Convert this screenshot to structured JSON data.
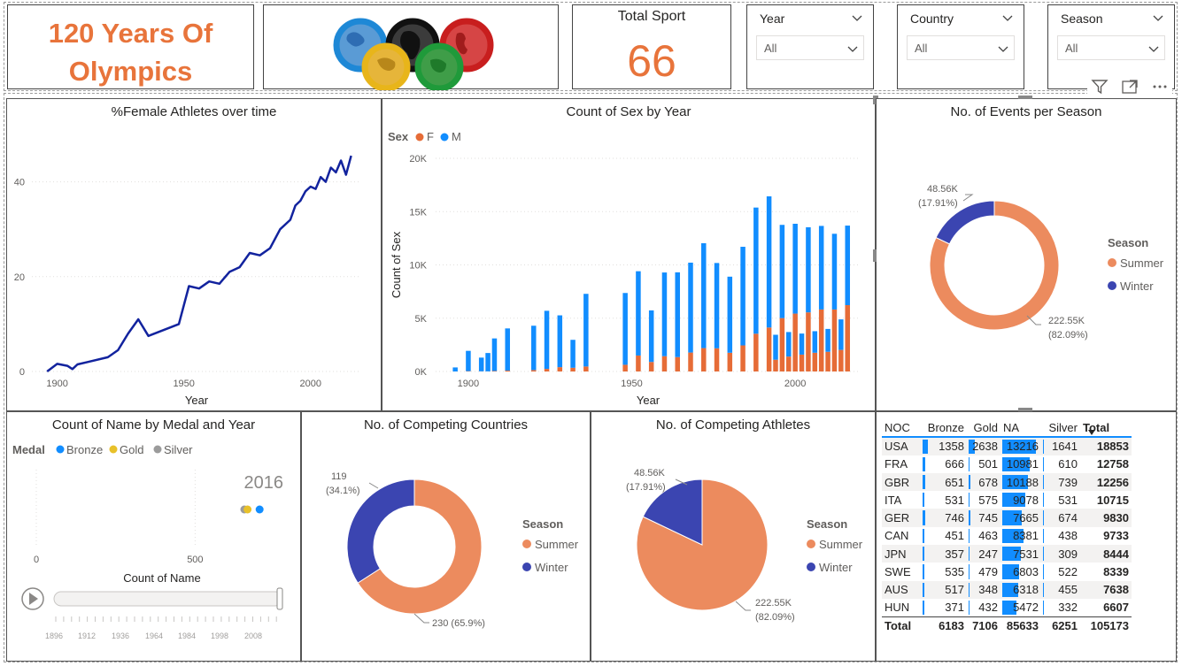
{
  "header": {
    "title_line1": "120 Years Of",
    "title_line2": "Olympics",
    "total_sport_label": "Total Sport",
    "total_sport_value": "66"
  },
  "slicers": [
    {
      "label": "Year",
      "value": "All"
    },
    {
      "label": "Country",
      "value": "All"
    },
    {
      "label": "Season",
      "value": "All"
    }
  ],
  "visual_header_icons": [
    "filter-icon",
    "focus-mode-icon",
    "more-options-icon"
  ],
  "colors": {
    "female": "#e66c37",
    "male": "#118dff",
    "summer": "#ec8b5e",
    "winter": "#3b45b1",
    "line": "#12239e",
    "bronze": "#118dff",
    "gold": "#e8c12a",
    "silver": "#9b9b9b",
    "title_orange": "#e8743b"
  },
  "female_pct": {
    "title": "%Female Athletes over time",
    "xlabel": "Year"
  },
  "sex_by_year": {
    "title": "Count of Sex by Year",
    "xlabel": "Year",
    "ylabel": "Count of Sex",
    "legend_title": "Sex",
    "legend": [
      "F",
      "M"
    ]
  },
  "events_per_season": {
    "title": "No. of Events per Season",
    "legend_title": "Season",
    "legend": [
      "Summer",
      "Winter"
    ],
    "label_summer_1": "222.55K",
    "label_summer_2": "(82.09%)",
    "label_winter_1": "48.56K",
    "label_winter_2": "(17.91%)"
  },
  "medal_scatter": {
    "title": "Count of Name by Medal and Year",
    "legend_title": "Medal",
    "legend": [
      "Bronze",
      "Gold",
      "Silver"
    ],
    "year_label": "2016",
    "xlabel": "Count of Name",
    "x_ticks": [
      "0",
      "500"
    ],
    "play_axis_ticks": [
      "1896",
      "1912",
      "1936",
      "1964",
      "1984",
      "1998",
      "2008"
    ]
  },
  "competing_countries": {
    "title": "No. of Competing Countries",
    "legend_title": "Season",
    "legend": [
      "Summer",
      "Winter"
    ],
    "label_summer": "230 (65.9%)",
    "label_winter_1": "119",
    "label_winter_2": "(34.1%)"
  },
  "competing_athletes": {
    "title": "No. of Competing Athletes",
    "legend_title": "Season",
    "legend": [
      "Summer",
      "Winter"
    ],
    "label_summer_1": "222.55K",
    "label_summer_2": "(82.09%)",
    "label_winter_1": "48.56K",
    "label_winter_2": "(17.91%)"
  },
  "medal_table": {
    "columns": [
      "NOC",
      "Bronze",
      "Gold",
      "NA",
      "Silver",
      "Total"
    ],
    "rows": [
      [
        "USA",
        1358,
        2638,
        13216,
        1641,
        18853
      ],
      [
        "FRA",
        666,
        501,
        10981,
        610,
        12758
      ],
      [
        "GBR",
        651,
        678,
        10188,
        739,
        12256
      ],
      [
        "ITA",
        531,
        575,
        9078,
        531,
        10715
      ],
      [
        "GER",
        746,
        745,
        7665,
        674,
        9830
      ],
      [
        "CAN",
        451,
        463,
        8381,
        438,
        9733
      ],
      [
        "JPN",
        357,
        247,
        7531,
        309,
        8444
      ],
      [
        "SWE",
        535,
        479,
        6803,
        522,
        8339
      ],
      [
        "AUS",
        517,
        348,
        6318,
        455,
        7638
      ],
      [
        "HUN",
        371,
        432,
        5472,
        332,
        6607
      ]
    ],
    "total_row": [
      "Total",
      6183,
      7106,
      85633,
      6251,
      105173
    ]
  },
  "chart_data": [
    {
      "type": "line",
      "title": "%Female Athletes over time",
      "xlabel": "Year",
      "ylabel": "",
      "xlim": [
        1890,
        2020
      ],
      "ylim": [
        0,
        50
      ],
      "x_ticks": [
        1900,
        1950,
        2000
      ],
      "y_ticks": [
        0,
        20,
        40
      ],
      "grid": true,
      "x": [
        1896,
        1900,
        1904,
        1906,
        1908,
        1912,
        1920,
        1924,
        1928,
        1932,
        1936,
        1948,
        1952,
        1956,
        1960,
        1964,
        1968,
        1972,
        1976,
        1980,
        1984,
        1988,
        1992,
        1994,
        1996,
        1998,
        2000,
        2002,
        2004,
        2006,
        2008,
        2010,
        2012,
        2014,
        2016
      ],
      "values": [
        0,
        1.6,
        1.2,
        0.5,
        1.5,
        2,
        3,
        4.5,
        8,
        11,
        7.5,
        10,
        18,
        17.5,
        19,
        18.5,
        21,
        22,
        25,
        24.5,
        26,
        30,
        32,
        35,
        36,
        38,
        39,
        38.5,
        41,
        40,
        43,
        42,
        44.5,
        41.5,
        45.5
      ]
    },
    {
      "type": "bar",
      "title": "Count of Sex by Year",
      "xlabel": "Year",
      "ylabel": "Count of Sex",
      "ylim": [
        0,
        20000
      ],
      "y_ticks": [
        "0K",
        "5K",
        "10K",
        "15K",
        "20K"
      ],
      "x_ticks": [
        1900,
        1950,
        2000
      ],
      "legend_title": "Sex",
      "categories": [
        1896,
        1900,
        1904,
        1906,
        1908,
        1912,
        1920,
        1924,
        1928,
        1932,
        1936,
        1948,
        1952,
        1956,
        1960,
        1964,
        1968,
        1972,
        1976,
        1980,
        1984,
        1988,
        1992,
        1994,
        1996,
        1998,
        2000,
        2002,
        2004,
        2006,
        2008,
        2010,
        2012,
        2014,
        2016
      ],
      "series": [
        {
          "name": "F",
          "values": [
            0,
            33,
            16,
            11,
            47,
            87,
            134,
            244,
            404,
            347,
            468,
            628,
            1497,
            893,
            1435,
            1348,
            1777,
            2193,
            2172,
            1756,
            2447,
            3543,
            4124,
            1105,
            5008,
            1400,
            5431,
            1582,
            5546,
            1757,
            5816,
            1847,
            5815,
            2023,
            6223
          ]
        },
        {
          "name": "M",
          "values": [
            380,
            1903,
            1285,
            1722,
            3054,
            3953,
            4158,
            5451,
            4862,
            2622,
            6816,
            6736,
            7909,
            4837,
            7853,
            7954,
            8434,
            9839,
            8006,
            7139,
            9252,
            11837,
            12307,
            2339,
            8748,
            2300,
            8428,
            1976,
            7986,
            2023,
            7842,
            2145,
            7105,
            2866,
            7465
          ]
        }
      ]
    },
    {
      "type": "pie",
      "title": "No. of Events per Season",
      "legend_title": "Season",
      "labels": [
        "Summer",
        "Winter"
      ],
      "values": [
        222550,
        48560
      ],
      "percent": [
        82.09,
        17.91
      ]
    },
    {
      "type": "scatter",
      "title": "Count of Name by Medal and Year",
      "xlabel": "Count of Name",
      "legend_title": "Medal",
      "frame_year": 2016,
      "xlim": [
        0,
        800
      ],
      "series": [
        {
          "name": "Bronze",
          "x": [
            703
          ]
        },
        {
          "name": "Gold",
          "x": [
            665
          ]
        },
        {
          "name": "Silver",
          "x": [
            655
          ]
        }
      ]
    },
    {
      "type": "pie",
      "title": "No. of Competing Countries",
      "legend_title": "Season",
      "labels": [
        "Summer",
        "Winter"
      ],
      "values": [
        230,
        119
      ],
      "percent": [
        65.9,
        34.1
      ]
    },
    {
      "type": "pie",
      "title": "No. of Competing Athletes",
      "legend_title": "Season",
      "labels": [
        "Summer",
        "Winter"
      ],
      "values": [
        222550,
        48560
      ],
      "percent": [
        82.09,
        17.91
      ]
    }
  ]
}
